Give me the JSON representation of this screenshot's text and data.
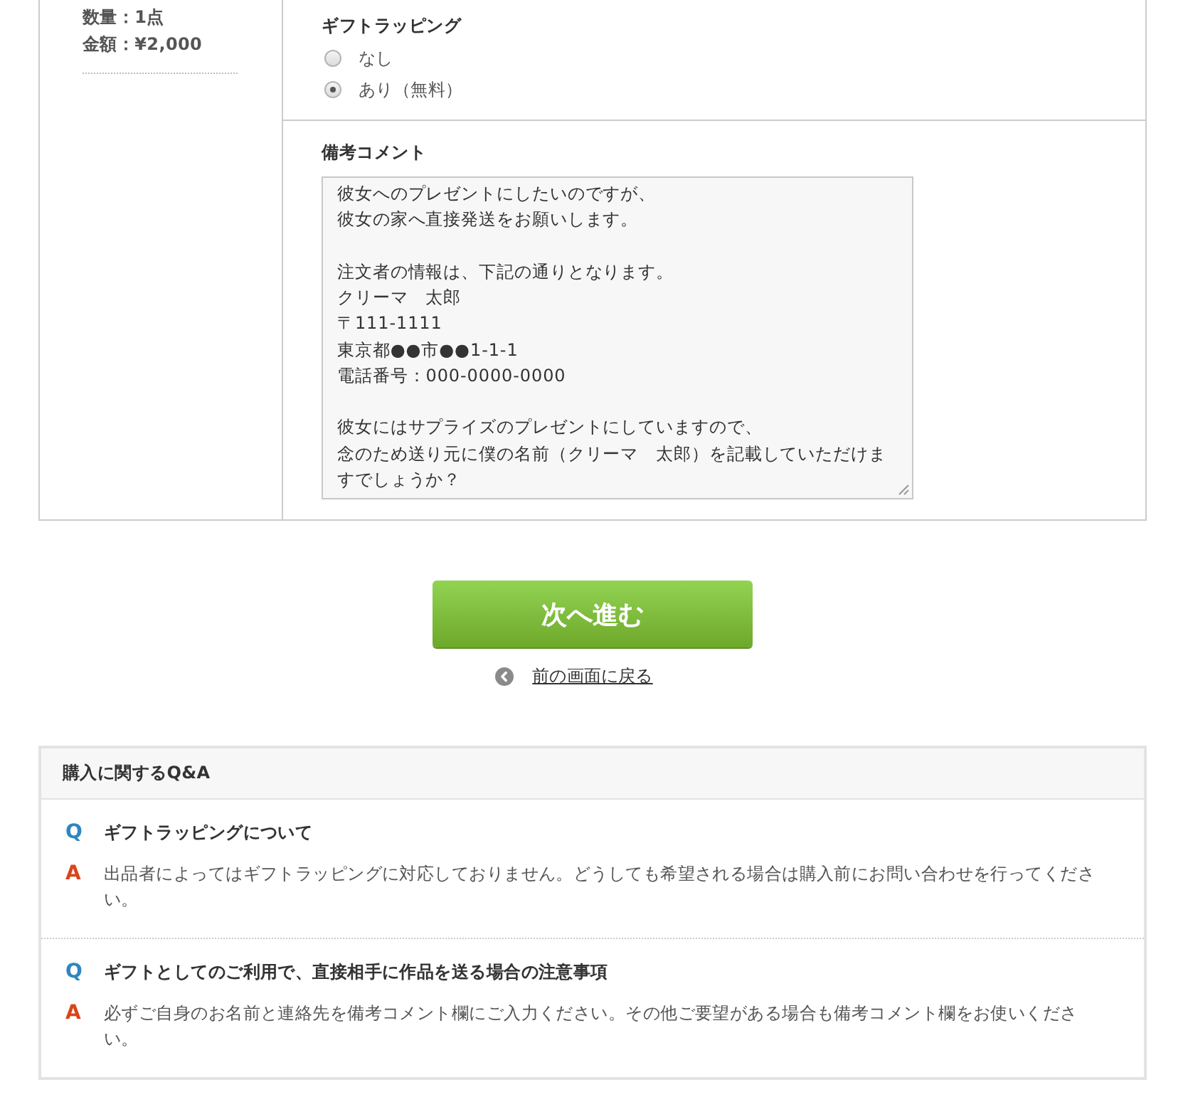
{
  "order_summary": {
    "quantity": "数量：1点",
    "amount": "金額：¥2,000"
  },
  "gift_wrapping": {
    "label": "ギフトラッピング",
    "options": [
      {
        "label": "なし",
        "selected": false
      },
      {
        "label": "あり（無料）",
        "selected": true
      }
    ]
  },
  "comment": {
    "label": "備考コメント",
    "paragraphs": [
      {
        "lines": [
          "彼女へのプレゼントにしたいのですが、",
          "彼女の家へ直接発送をお願いします。"
        ]
      },
      {
        "lines": [
          "注文者の情報は、下記の通りとなります。",
          "クリーマ　太郎",
          "〒111-1111",
          "東京都●●市●●1-1-1",
          "電話番号：000-0000-0000"
        ]
      },
      {
        "lines": [
          "彼女にはサプライズのプレゼントにしていますので、",
          "念のため送り元に僕の名前（クリーマ　太郎）を記載していただけますでしょうか？"
        ]
      }
    ]
  },
  "next_button": {
    "label": "次へ進む"
  },
  "back_link": {
    "label": "前の画面に戻る"
  },
  "qa": {
    "title": "購入に関するQ&A",
    "items": [
      {
        "q_mark": "Q",
        "question": "ギフトラッピングについて",
        "a_mark": "A",
        "answer": "出品者によってはギフトラッピングに対応しておりません。どうしても希望される場合は購入前にお問い合わせを行ってください。"
      },
      {
        "q_mark": "Q",
        "question": "ギフトとしてのご利用で、直接相手に作品を送る場合の注意事項",
        "a_mark": "A",
        "answer": "必ずご自身のお名前と連絡先を備考コメント欄にご入力ください。その他ご要望がある場合も備考コメント欄をお使いください。"
      }
    ]
  }
}
